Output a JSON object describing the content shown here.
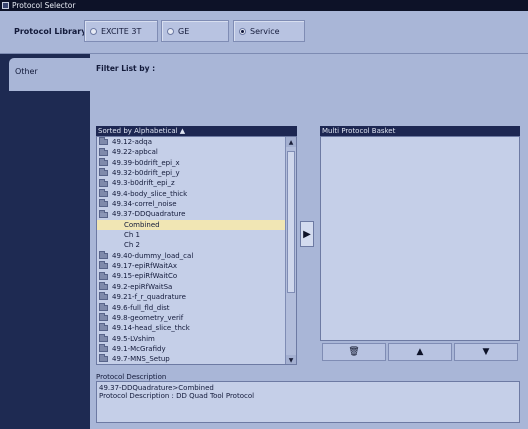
{
  "window": {
    "title": "Protocol Selector"
  },
  "library": {
    "label": "Protocol Library :",
    "options": [
      {
        "label": "EXCITE 3T",
        "selected": false
      },
      {
        "label": "GE",
        "selected": false
      },
      {
        "label": "Service",
        "selected": true
      }
    ]
  },
  "tabs": [
    {
      "label": "Other"
    }
  ],
  "filter": {
    "label": "Filter List by :"
  },
  "sorted_list": {
    "header": "Sorted by Alphabetical ▲",
    "items": [
      {
        "label": "49.12-adqa",
        "type": "folder"
      },
      {
        "label": "49.22-apbcal",
        "type": "folder"
      },
      {
        "label": "49.39-b0drift_epi_x",
        "type": "folder"
      },
      {
        "label": "49.32-b0drift_epi_y",
        "type": "folder"
      },
      {
        "label": "49.3-b0drift_epi_z",
        "type": "folder"
      },
      {
        "label": "49.4-body_slice_thick",
        "type": "folder"
      },
      {
        "label": "49.34-correl_noise",
        "type": "folder"
      },
      {
        "label": "49.37-DDQuadrature",
        "type": "folder-open"
      },
      {
        "label": "Combined",
        "type": "child",
        "selected": true
      },
      {
        "label": "Ch 1",
        "type": "child"
      },
      {
        "label": "Ch 2",
        "type": "child"
      },
      {
        "label": "49.40-dummy_load_cal",
        "type": "folder"
      },
      {
        "label": "49.17-epiRfWaitAx",
        "type": "folder"
      },
      {
        "label": "49.15-epiRfWaitCo",
        "type": "folder"
      },
      {
        "label": "49.2-epiRfWaitSa",
        "type": "folder"
      },
      {
        "label": "49.21-f_r_quadrature",
        "type": "folder"
      },
      {
        "label": "49.6-full_fld_dist",
        "type": "folder"
      },
      {
        "label": "49.8-geometry_verif",
        "type": "folder"
      },
      {
        "label": "49.14-head_slice_thck",
        "type": "folder"
      },
      {
        "label": "49.5-LVshim",
        "type": "folder"
      },
      {
        "label": "49.1-McGrafidy",
        "type": "folder"
      },
      {
        "label": "49.7-MNS_Setup",
        "type": "folder"
      }
    ]
  },
  "basket": {
    "header": "Multi Protocol Basket",
    "buttons": [
      {
        "icon": "trash-icon",
        "glyph": "🗑"
      },
      {
        "icon": "arrow-up-icon",
        "glyph": "▲"
      },
      {
        "icon": "arrow-down-icon",
        "glyph": "▼"
      }
    ]
  },
  "description": {
    "label": "Protocol Description",
    "line1": "49.37-DDQuadrature>Combined",
    "line2": "Protocol Description : DD Quad Tool Protocol"
  },
  "colors": {
    "panel": "#a9b6d7",
    "dark_bg": "#1e2a52",
    "header": "#1d2752",
    "selection": "#f1e6b4"
  }
}
